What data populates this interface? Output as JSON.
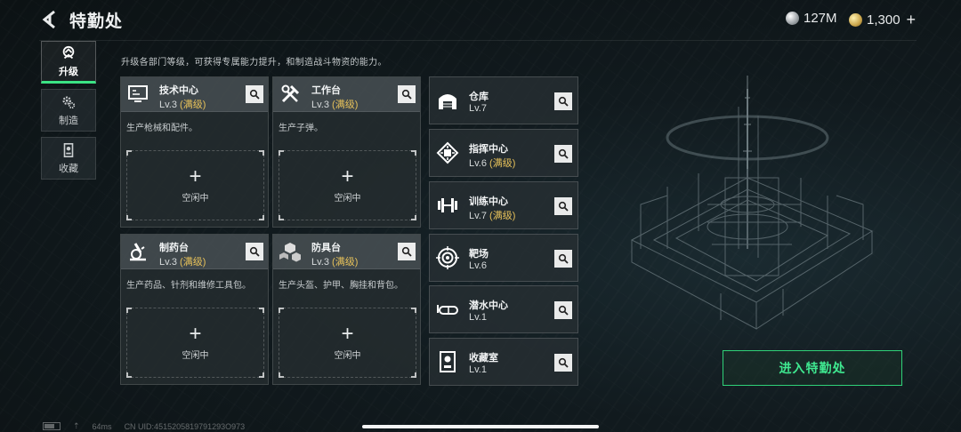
{
  "header": {
    "title": "特勤处",
    "currency_silver": "127M",
    "currency_gold": "1,300"
  },
  "nav": {
    "items": [
      {
        "label": "升级",
        "icon": "upgrade-icon",
        "active": true
      },
      {
        "label": "制造",
        "icon": "gears-icon",
        "active": false
      },
      {
        "label": "收藏",
        "icon": "collection-icon",
        "active": false
      }
    ]
  },
  "description": "升级各部门等级，可获得专属能力提升，和制造战斗物资的能力。",
  "cards": [
    {
      "name": "技术中心",
      "level": "Lv.3",
      "maxed": "(满级)",
      "desc": "生产枪械和配件。",
      "slot_label": "空闲中",
      "icon": "computer-icon"
    },
    {
      "name": "工作台",
      "level": "Lv.3",
      "maxed": "(满级)",
      "desc": "生产子弹。",
      "slot_label": "空闲中",
      "icon": "tools-icon"
    },
    {
      "name": "制药台",
      "level": "Lv.3",
      "maxed": "(满级)",
      "desc": "生产药品、针剂和维修工具包。",
      "slot_label": "空闲中",
      "icon": "microscope-icon"
    },
    {
      "name": "防具台",
      "level": "Lv.3",
      "maxed": "(满级)",
      "desc": "生产头盔、护甲、胸挂和背包。",
      "slot_label": "空闲中",
      "icon": "armor-boxes-icon"
    }
  ],
  "rows": [
    {
      "name": "仓库",
      "level": "Lv.7",
      "maxed": "",
      "icon": "warehouse-icon"
    },
    {
      "name": "指挥中心",
      "level": "Lv.6",
      "maxed": "(满级)",
      "icon": "chip-icon"
    },
    {
      "name": "训练中心",
      "level": "Lv.7",
      "maxed": "(满级)",
      "icon": "dumbbell-icon"
    },
    {
      "name": "靶场",
      "level": "Lv.6",
      "maxed": "",
      "icon": "target-icon"
    },
    {
      "name": "潜水中心",
      "level": "Lv.1",
      "maxed": "",
      "icon": "diving-mask-icon"
    },
    {
      "name": "收藏室",
      "level": "Lv.1",
      "maxed": "",
      "icon": "display-case-icon"
    }
  ],
  "enter_button": "进入特勤处",
  "footer": {
    "ping": "64ms",
    "uid": "CN UID:4515205819791293O973"
  },
  "colors": {
    "accent_green": "#3fe890",
    "maxed_gold": "#e6c15a"
  }
}
